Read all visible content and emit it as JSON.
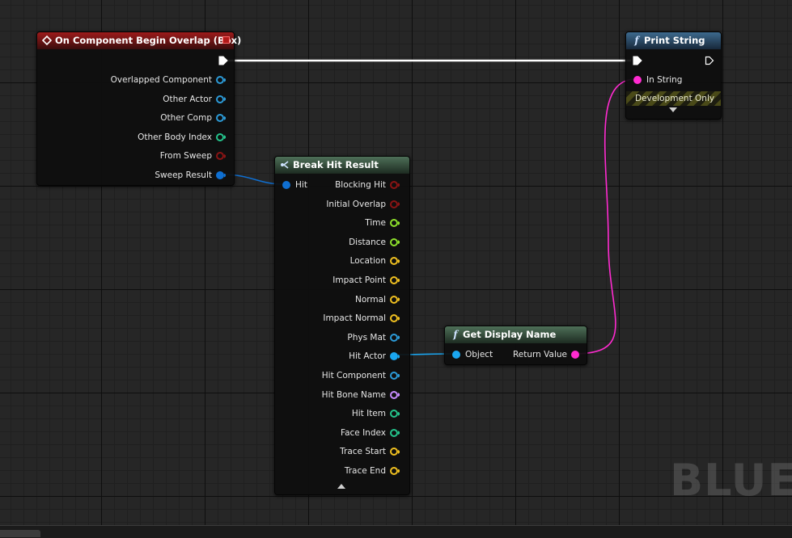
{
  "nodes": {
    "event": {
      "title": "On Component Begin Overlap (Box)",
      "header_color": "#9d1b1b",
      "icon": "event-diamond-icon",
      "outputs": [
        {
          "label": "Overlapped Component",
          "color": "#2c9bd8",
          "filled": false
        },
        {
          "label": "Other Actor",
          "color": "#2c9bd8",
          "filled": false
        },
        {
          "label": "Other Comp",
          "color": "#2c9bd8",
          "filled": false
        },
        {
          "label": "Other Body Index",
          "color": "#25c48c",
          "filled": false
        },
        {
          "label": "From Sweep",
          "color": "#8a1414",
          "filled": false
        },
        {
          "label": "Sweep Result",
          "color": "#0f6fd1",
          "filled": true
        }
      ]
    },
    "break_hit": {
      "title": "Break Hit Result",
      "header_color": "#4e7058",
      "icon": "struct-break-icon",
      "input": {
        "label": "Hit",
        "color": "#0f6fd1"
      },
      "outputs": [
        {
          "label": "Blocking Hit",
          "color": "#8a1414",
          "filled": false
        },
        {
          "label": "Initial Overlap",
          "color": "#8a1414",
          "filled": false
        },
        {
          "label": "Time",
          "color": "#8ee02c",
          "filled": false
        },
        {
          "label": "Distance",
          "color": "#8ee02c",
          "filled": false
        },
        {
          "label": "Location",
          "color": "#f0c020",
          "filled": false
        },
        {
          "label": "Impact Point",
          "color": "#f0c020",
          "filled": false
        },
        {
          "label": "Normal",
          "color": "#f0c020",
          "filled": false
        },
        {
          "label": "Impact Normal",
          "color": "#f0c020",
          "filled": false
        },
        {
          "label": "Phys Mat",
          "color": "#2c9bd8",
          "filled": false
        },
        {
          "label": "Hit Actor",
          "color": "#1aa6f0",
          "filled": true
        },
        {
          "label": "Hit Component",
          "color": "#2c9bd8",
          "filled": false
        },
        {
          "label": "Hit Bone Name",
          "color": "#c78cff",
          "filled": false
        },
        {
          "label": "Hit Item",
          "color": "#25c48c",
          "filled": false
        },
        {
          "label": "Face Index",
          "color": "#25c48c",
          "filled": false
        },
        {
          "label": "Trace Start",
          "color": "#f0c020",
          "filled": false
        },
        {
          "label": "Trace End",
          "color": "#f0c020",
          "filled": false
        }
      ]
    },
    "get_display_name": {
      "title": "Get Display Name",
      "header_color": "#4e7058",
      "icon": "function-icon",
      "input": {
        "label": "Object",
        "color": "#1aa6f0"
      },
      "output": {
        "label": "Return Value",
        "color": "#ff2bd0"
      }
    },
    "print_string": {
      "title": "Print String",
      "header_color": "#3d6a8e",
      "icon": "function-icon",
      "input": {
        "label": "In String",
        "color": "#ff2bd0"
      },
      "development_only": "Development Only"
    }
  },
  "colors": {
    "exec_wire": "#ffffff",
    "object_wire": "#1aa6f0",
    "struct_wire": "#0f6fd1",
    "string_wire": "#ff2bd0"
  },
  "watermark": "BLUEPRINT"
}
